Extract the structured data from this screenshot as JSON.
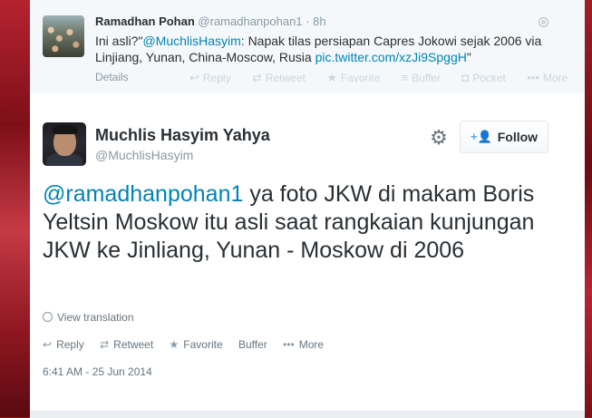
{
  "parent_tweet": {
    "name": "Ramadhan Pohan",
    "handle": "@ramadhanpohan1",
    "separator": " · ",
    "time": "8h",
    "text_before": "Ini asli?\"",
    "mention": "@MuchlisHasyim",
    "text_middle": ": Napak tilas persiapan Capres Jokowi sejak 2006 via Linjiang, Yunan, China-Moscow, Rusia ",
    "link": "pic.twitter.com/xzJi9SpggH",
    "text_after": "\"",
    "details_label": "Details",
    "actions": {
      "reply_icon": "↩",
      "reply": "Reply",
      "retweet_icon": "⇄",
      "retweet": "Retweet",
      "favorite_icon": "★",
      "favorite": "Favorite",
      "buffer_icon": "≡",
      "buffer": "Buffer",
      "pocket_icon": "◘",
      "pocket": "Pocket",
      "more_icon": "•••",
      "more": "More"
    }
  },
  "main_tweet": {
    "name": "Muchlis Hasyim Yahya",
    "handle": "@MuchlisHasyim",
    "gear_icon": "⚙",
    "follow_icon": "+👤",
    "follow_label": "Follow",
    "mention": "@ramadhanpohan1",
    "text": " ya foto JKW di makam Boris Yeltsin Moskow itu asli saat rangkaian kunjungan JKW ke Jinliang, Yunan - Moskow di 2006",
    "view_translation": "View translation",
    "actions": {
      "reply_icon": "↩",
      "reply": "Reply",
      "retweet_icon": "⇄",
      "retweet": "Retweet",
      "favorite_icon": "★",
      "favorite": "Favorite",
      "buffer": "Buffer",
      "more_icon": "•••",
      "more": "More"
    },
    "timestamp": "6:41 AM - 25 Jun 2014"
  },
  "colors": {
    "link": "#0084b4",
    "text": "#292f33",
    "muted": "#8899a6",
    "accent_icon": "#55acee",
    "page_background": "#8a1a20"
  }
}
